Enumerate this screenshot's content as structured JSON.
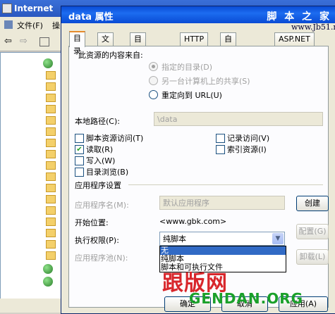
{
  "background_window": {
    "title": "Internet",
    "menu_file": "文件(F)",
    "menu_more": "操"
  },
  "dialog": {
    "title": "data 属性",
    "watermark_top": "脚 本 之 家",
    "watermark_url": "www.Jb51.net",
    "tabs": [
      "目录",
      "文档",
      "目录安全性",
      "HTTP 头",
      "自定义错误",
      "ASP.NET"
    ],
    "active_tab": "目录",
    "content_source": {
      "heading": "此资源的内容来自:",
      "options": [
        {
          "label": "指定的目录(D)",
          "selected": true,
          "enabled": true
        },
        {
          "label": "另一台计算机上的共享(S)",
          "selected": false,
          "enabled": false
        },
        {
          "label": "重定向到 URL(U)",
          "selected": false,
          "enabled": true
        }
      ]
    },
    "local_path": {
      "label": "本地路径(C):",
      "value": "\\data"
    },
    "permissions": [
      {
        "label": "脚本资源访问(T)",
        "checked": false
      },
      {
        "label": "记录访问(V)",
        "checked": false
      },
      {
        "label": "读取(R)",
        "checked": true
      },
      {
        "label": "索引资源(I)",
        "checked": false
      },
      {
        "label": "写入(W)",
        "checked": false
      },
      {
        "label": "目录浏览(B)",
        "checked": false
      }
    ],
    "app_settings": {
      "heading": "应用程序设置",
      "app_name_label": "应用程序名(M):",
      "app_name_value": "默认应用程序",
      "create_button": "创建",
      "start_label": "开始位置:",
      "start_value": "<www.gbk.com>",
      "exec_label": "执行权限(P):",
      "exec_value": "纯脚本",
      "exec_options": [
        "无",
        "纯脚本",
        "脚本和可执行文件"
      ],
      "exec_highlighted": "无",
      "config_button": "配置(G)",
      "pool_label": "应用程序池(N):",
      "unload_button": "卸载(L)"
    },
    "footer_buttons": {
      "ok": "确定",
      "cancel": "取消",
      "apply": "应用(A)"
    },
    "watermark_logo": "跟版网",
    "watermark_logo_sub": "GENDAN.ORG"
  }
}
